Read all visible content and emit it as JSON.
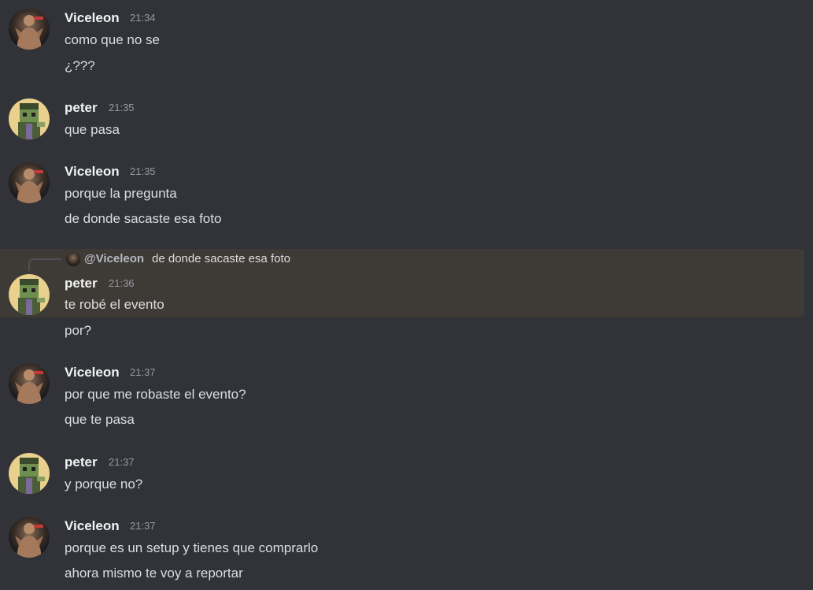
{
  "channel": {
    "groups": [
      {
        "author": "Viceleon",
        "time": "21:34",
        "lines": [
          "como que no se",
          "¿???"
        ]
      },
      {
        "author": "peter",
        "time": "21:35",
        "lines": [
          "que pasa"
        ]
      },
      {
        "author": "Viceleon",
        "time": "21:35",
        "lines": [
          "porque la pregunta",
          "de donde sacaste esa foto"
        ]
      },
      {
        "author": "peter",
        "time": "21:36",
        "reply": {
          "mention": "@Viceleon",
          "text": "de donde sacaste esa foto"
        },
        "lines": [
          "te robé el evento",
          "por?"
        ]
      },
      {
        "author": "Viceleon",
        "time": "21:37",
        "lines": [
          "por que me robaste el evento?",
          "que te pasa"
        ]
      },
      {
        "author": "peter",
        "time": "21:37",
        "lines": [
          "y porque no?"
        ]
      },
      {
        "author": "Viceleon",
        "time": "21:37",
        "lines": [
          "porque es un setup y tienes que comprarlo",
          "ahora mismo te voy a reportar"
        ]
      }
    ]
  },
  "icons": {
    "viceleon_avatar": "viceleon-avatar-icon",
    "peter_avatar": "peter-avatar-icon"
  },
  "colors": {
    "background": "#313338",
    "highlight": "#3e3a35",
    "username": "#f2f3f5",
    "timestamp": "#949ba4",
    "text": "#dbdee1"
  }
}
